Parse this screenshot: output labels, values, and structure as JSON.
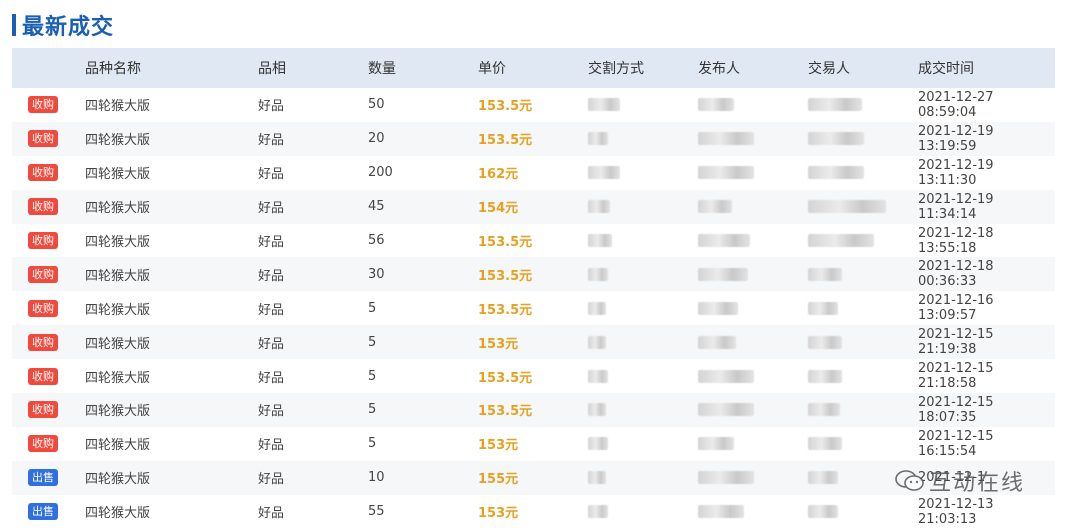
{
  "section_title": "最新成交",
  "headers": [
    "品种名称",
    "品相",
    "数量",
    "单价",
    "交割方式",
    "发布人",
    "交易人",
    "成交时间"
  ],
  "colors": {
    "buy_tag": "#f04a3e",
    "sell_tag": "#2f6fe0",
    "price": "#e7a020",
    "title": "#1a5fb4",
    "header_bg": "#dfe8f3"
  },
  "watermark": {
    "text": "互动在线",
    "icon": "wechat-icon"
  },
  "rows": [
    {
      "tag": "收购",
      "type": "buy",
      "name": "四轮猴大版",
      "quality": "好品",
      "qty": "50",
      "price": "153.5元",
      "way": "░░",
      "publisher": "░░",
      "trader": "░░",
      "time": "2021-12-27 08:59:04"
    },
    {
      "tag": "收购",
      "type": "buy",
      "name": "四轮猴大版",
      "quality": "好品",
      "qty": "20",
      "price": "153.5元",
      "way": "░░",
      "publisher": "░░",
      "trader": "░░",
      "time": "2021-12-19 13:19:59"
    },
    {
      "tag": "收购",
      "type": "buy",
      "name": "四轮猴大版",
      "quality": "好品",
      "qty": "200",
      "price": "162元",
      "way": "░░",
      "publisher": "░░",
      "trader": "░░",
      "time": "2021-12-19 13:11:30"
    },
    {
      "tag": "收购",
      "type": "buy",
      "name": "四轮猴大版",
      "quality": "好品",
      "qty": "45",
      "price": "154元",
      "way": "░░",
      "publisher": "░░",
      "trader": "░░",
      "time": "2021-12-19 11:34:14"
    },
    {
      "tag": "收购",
      "type": "buy",
      "name": "四轮猴大版",
      "quality": "好品",
      "qty": "56",
      "price": "153.5元",
      "way": "░░",
      "publisher": "░░",
      "trader": "░░",
      "time": "2021-12-18 13:55:18"
    },
    {
      "tag": "收购",
      "type": "buy",
      "name": "四轮猴大版",
      "quality": "好品",
      "qty": "30",
      "price": "153.5元",
      "way": "░░",
      "publisher": "░░",
      "trader": "░░",
      "time": "2021-12-18 00:36:33"
    },
    {
      "tag": "收购",
      "type": "buy",
      "name": "四轮猴大版",
      "quality": "好品",
      "qty": "5",
      "price": "153.5元",
      "way": "░░",
      "publisher": "░░",
      "trader": "░░",
      "time": "2021-12-16 13:09:57"
    },
    {
      "tag": "收购",
      "type": "buy",
      "name": "四轮猴大版",
      "quality": "好品",
      "qty": "5",
      "price": "153元",
      "way": "░░",
      "publisher": "░░",
      "trader": "░░",
      "time": "2021-12-15 21:19:38"
    },
    {
      "tag": "收购",
      "type": "buy",
      "name": "四轮猴大版",
      "quality": "好品",
      "qty": "5",
      "price": "153.5元",
      "way": "░░",
      "publisher": "░░",
      "trader": "░░",
      "time": "2021-12-15 21:18:58"
    },
    {
      "tag": "收购",
      "type": "buy",
      "name": "四轮猴大版",
      "quality": "好品",
      "qty": "5",
      "price": "153.5元",
      "way": "░░",
      "publisher": "░░",
      "trader": "░░",
      "time": "2021-12-15 18:07:35"
    },
    {
      "tag": "收购",
      "type": "buy",
      "name": "四轮猴大版",
      "quality": "好品",
      "qty": "5",
      "price": "153元",
      "way": "░░",
      "publisher": "░░",
      "trader": "░░",
      "time": "2021-12-15 16:15:54"
    },
    {
      "tag": "出售",
      "type": "sell",
      "name": "四轮猴大版",
      "quality": "好品",
      "qty": "10",
      "price": "155元",
      "way": "░░",
      "publisher": "░░",
      "trader": "░░",
      "time": "2021-12-1"
    },
    {
      "tag": "出售",
      "type": "sell",
      "name": "四轮猴大版",
      "quality": "好品",
      "qty": "55",
      "price": "153元",
      "way": "░░",
      "publisher": "░░",
      "trader": "░░",
      "time": "2021-12-13 21:03:13"
    }
  ]
}
